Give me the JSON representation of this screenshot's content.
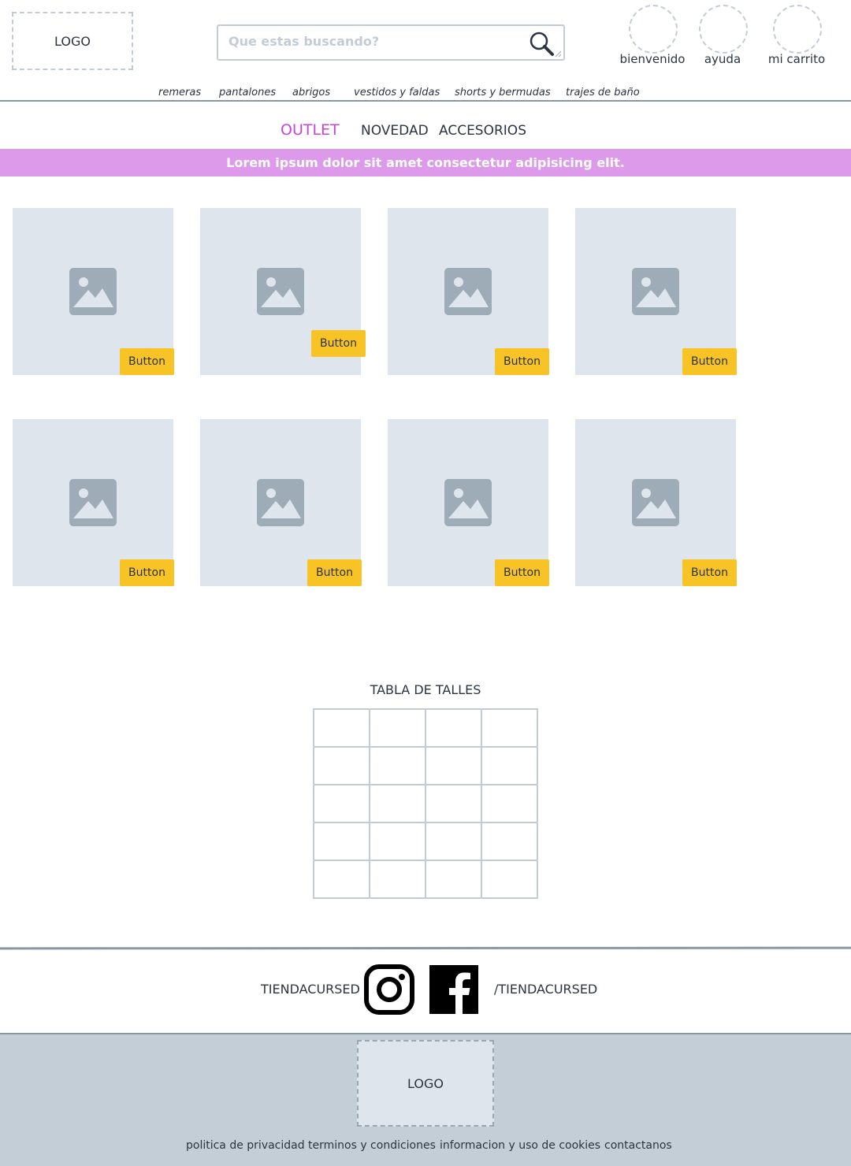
{
  "header": {
    "logo": "LOGO",
    "search_placeholder": "Que estas buscando?",
    "user_menu": [
      "bienvenido",
      "ayuda",
      "mi carrito"
    ]
  },
  "categories": [
    "remeras",
    "pantalones",
    "abrigos",
    "vestidos y faldas",
    "shorts y bermudas",
    "trajes de baño"
  ],
  "tabs": [
    {
      "label": "OUTLET",
      "active": true
    },
    {
      "label": "NOVEDAD",
      "active": false
    },
    {
      "label": "ACCESORIOS",
      "active": false
    }
  ],
  "banner": "Lorem ipsum dolor sit amet consectetur adipisicing elit.",
  "products": {
    "button_label": "Button",
    "count": 8
  },
  "size_table": {
    "title": "TABLA DE TALLES",
    "rows": 5,
    "cols": 4
  },
  "social": {
    "left_label": "TIENDACURSED",
    "right_label": "/TIENDACURSED"
  },
  "footer": {
    "logo": "LOGO",
    "links": [
      "politica de privacidad",
      "terminos y condiciones",
      "informacion y uso de cookies",
      "contactanos"
    ]
  },
  "colors": {
    "accent": "#c644d8",
    "banner": "#de9aea",
    "button": "#f7c325",
    "placeholder_bg": "#dfe5ec",
    "footer_bg": "#c3ced7"
  }
}
